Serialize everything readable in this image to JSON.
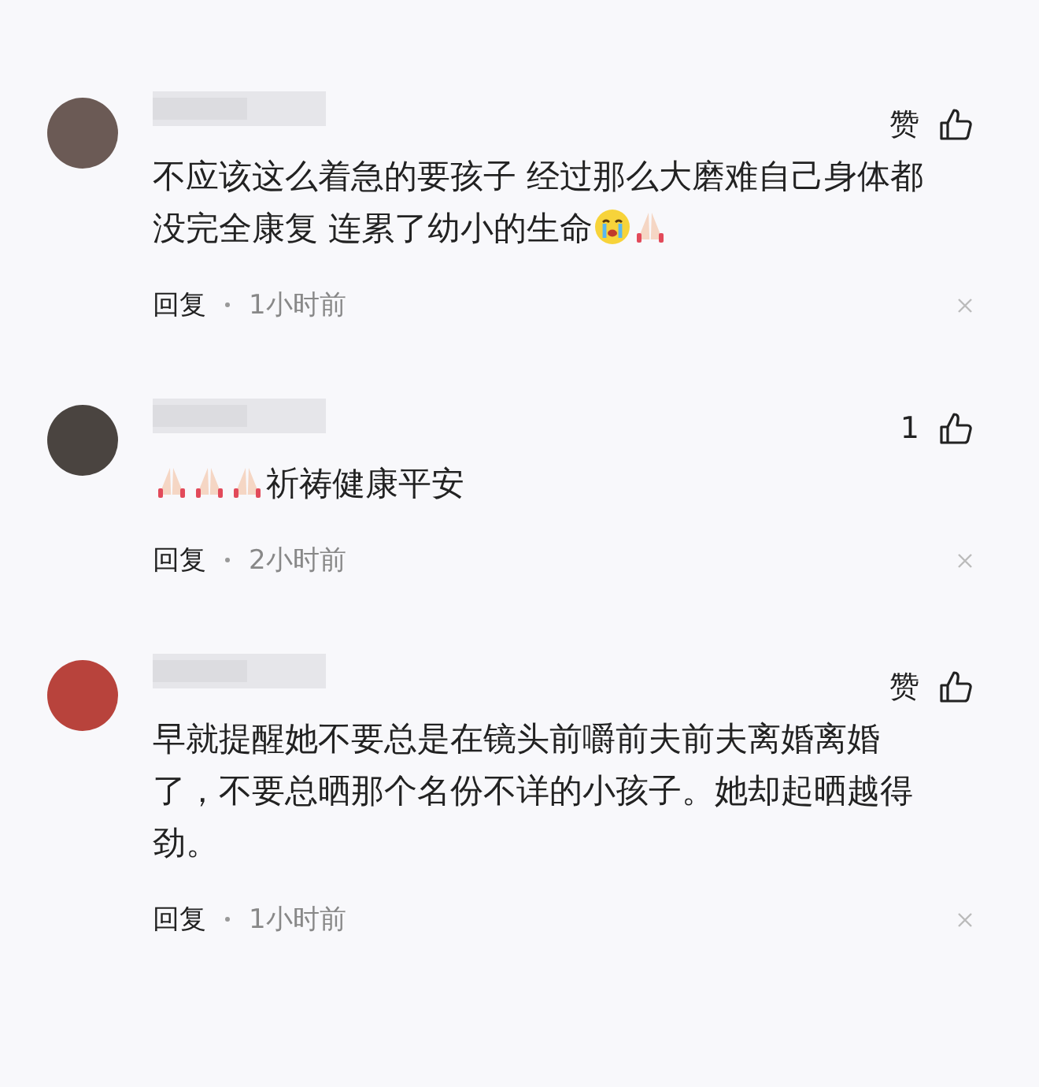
{
  "comments": [
    {
      "color": "#6b5a55",
      "like_label": "赞",
      "content": [
        {
          "kind": "text",
          "text": "不应该这么着急的要孩子 经过那么大磨难自己身体都没完全康复 连累了幼小的生命"
        },
        {
          "kind": "crying"
        },
        {
          "kind": "praying"
        }
      ],
      "reply": "回复",
      "time": "1小时前"
    },
    {
      "color": "#4a4440",
      "like_label": "1",
      "content": [
        {
          "kind": "praying"
        },
        {
          "kind": "praying"
        },
        {
          "kind": "praying"
        },
        {
          "kind": "text",
          "text": "祈祷健康平安"
        }
      ],
      "reply": "回复",
      "time": "2小时前"
    },
    {
      "color": "#b8433c",
      "like_label": "赞",
      "content": [
        {
          "kind": "text",
          "text": "早就提醒她不要总是在镜头前嚼前夫前夫离婚离婚了，不要总晒那个名份不详的小孩子。她却起晒越得劲。"
        }
      ],
      "reply": "回复",
      "time": "1小时前"
    }
  ]
}
